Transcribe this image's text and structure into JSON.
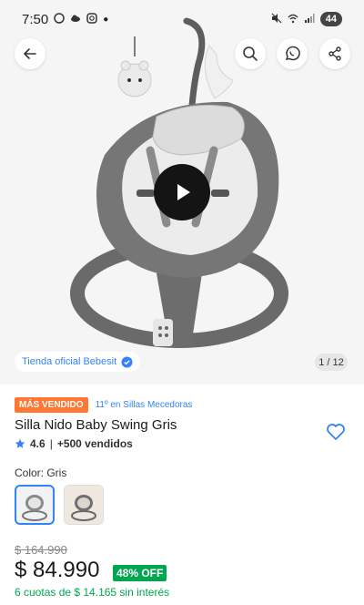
{
  "status_bar": {
    "time": "7:50",
    "battery": "44"
  },
  "product": {
    "badge": "MÁS VENDIDO",
    "ranking": "11º en Sillas Mecedoras",
    "title": "Silla Nido Baby Swing Gris",
    "rating": "4.6",
    "sold": "+500 vendidos",
    "color_label": "Color: Gris",
    "old_price": "$ 164.990",
    "price": "$ 84.990",
    "discount": "48% OFF",
    "installments": "6 cuotas de $ 14.165  sin interés"
  },
  "gallery": {
    "official_store": "Tienda oficial Bebesit",
    "counter": "1 / 12"
  },
  "colors": {
    "accent": "#3483fa",
    "badge": "#ff7733",
    "discount": "#00a650"
  },
  "icons": [
    "back-icon",
    "search-icon",
    "whatsapp-icon",
    "share-icon",
    "play-icon",
    "verified-icon",
    "star-icon",
    "heart-icon"
  ]
}
